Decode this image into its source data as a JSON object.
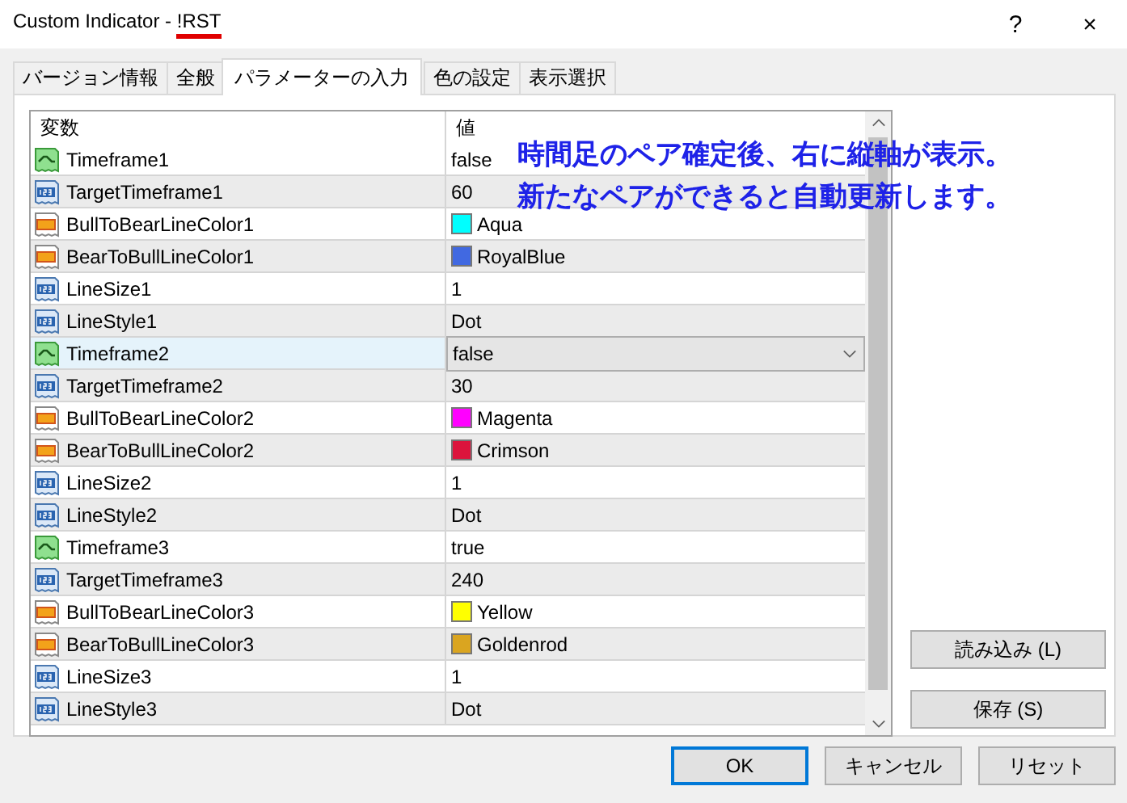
{
  "window": {
    "title": "Custom Indicator - ",
    "title_highlight": "!RST",
    "buttons": [
      "?",
      "×"
    ]
  },
  "tabs": [
    {
      "label": "バージョン情報",
      "selected": false
    },
    {
      "label": "全般",
      "selected": false
    },
    {
      "label": "パラメーターの入力",
      "selected": true
    },
    {
      "label": "色の設定",
      "selected": false
    },
    {
      "label": "表示選択",
      "selected": false
    }
  ],
  "table": {
    "columns": [
      "変数",
      "値"
    ],
    "rows": [
      {
        "kind": "bool",
        "name": "Timeframe1",
        "value": "false",
        "selected": false
      },
      {
        "kind": "int",
        "name": "TargetTimeframe1",
        "value": "60",
        "selected": false
      },
      {
        "kind": "color",
        "name": "BullToBearLineColor1",
        "value": "Aqua",
        "color": "#00ffff",
        "selected": false
      },
      {
        "kind": "color",
        "name": "BearToBullLineColor1",
        "value": "RoyalBlue",
        "color": "#4169e1",
        "selected": false
      },
      {
        "kind": "int",
        "name": "LineSize1",
        "value": "1",
        "selected": false
      },
      {
        "kind": "int",
        "name": "LineStyle1",
        "value": "Dot",
        "selected": false
      },
      {
        "kind": "bool",
        "name": "Timeframe2",
        "value": "false",
        "selected": true
      },
      {
        "kind": "int",
        "name": "TargetTimeframe2",
        "value": "30",
        "selected": false
      },
      {
        "kind": "color",
        "name": "BullToBearLineColor2",
        "value": "Magenta",
        "color": "#ff00ff",
        "selected": false
      },
      {
        "kind": "color",
        "name": "BearToBullLineColor2",
        "value": "Crimson",
        "color": "#dc143c",
        "selected": false
      },
      {
        "kind": "int",
        "name": "LineSize2",
        "value": "1",
        "selected": false
      },
      {
        "kind": "int",
        "name": "LineStyle2",
        "value": "Dot",
        "selected": false
      },
      {
        "kind": "bool",
        "name": "Timeframe3",
        "value": "true",
        "selected": false
      },
      {
        "kind": "int",
        "name": "TargetTimeframe3",
        "value": "240",
        "selected": false
      },
      {
        "kind": "color",
        "name": "BullToBearLineColor3",
        "value": "Yellow",
        "color": "#ffff00",
        "selected": false
      },
      {
        "kind": "color",
        "name": "BearToBullLineColor3",
        "value": "Goldenrod",
        "color": "#daa520",
        "selected": false
      },
      {
        "kind": "int",
        "name": "LineSize3",
        "value": "1",
        "selected": false
      },
      {
        "kind": "int",
        "name": "LineStyle3",
        "value": "Dot",
        "selected": false
      }
    ]
  },
  "annotation": [
    "時間足のペア確定後、右に縦軸が表示。",
    "新たなペアができると自動更新します。"
  ],
  "side_buttons": [
    "読み込み (L)",
    "保存 (S)"
  ],
  "footer_buttons": [
    {
      "label": "OK",
      "default": true
    },
    {
      "label": "キャンセル",
      "default": false
    },
    {
      "label": "リセット",
      "default": false
    }
  ]
}
